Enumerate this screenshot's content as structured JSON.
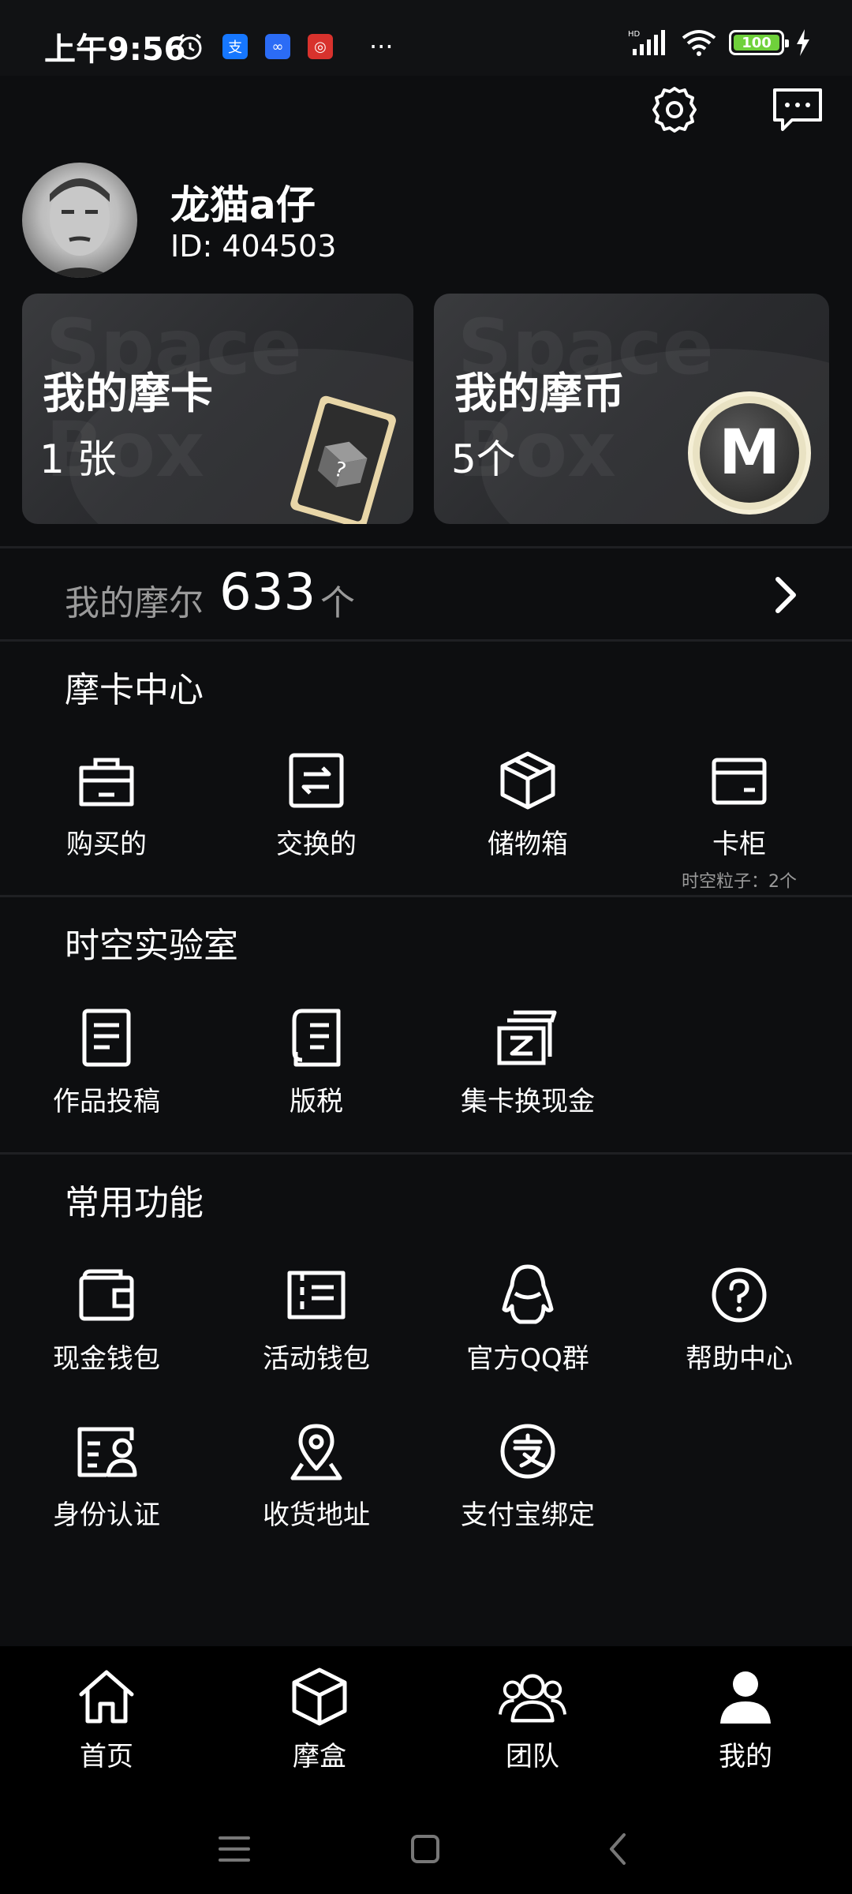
{
  "status_bar": {
    "time": "上午9:56",
    "battery": "100",
    "colors": {
      "battery_fill": "#6fd13b"
    }
  },
  "profile": {
    "name": "龙猫a仔",
    "id": "ID: 404503"
  },
  "cards": [
    {
      "title": "我的摩卡",
      "count": "1 张",
      "watermark_top": "Space",
      "watermark_bottom": "Box"
    },
    {
      "title": "我的摩币",
      "count": "5个",
      "watermark_top": "Space",
      "watermark_bottom": "Box",
      "coin_letter": "M"
    }
  ],
  "mole": {
    "label": "我的摩尔",
    "value": "633",
    "unit": "个"
  },
  "sections": {
    "moka_center": {
      "title": "摩卡中心",
      "items": [
        {
          "label": "购买的",
          "icon": "shopping-bag-icon"
        },
        {
          "label": "交换的",
          "icon": "exchange-icon"
        },
        {
          "label": "储物箱",
          "icon": "box-icon"
        },
        {
          "label": "卡柜",
          "icon": "card-cabinet-icon",
          "sub": "时空粒子：2个"
        }
      ]
    },
    "lab": {
      "title": "时空实验室",
      "items": [
        {
          "label": "作品投稿",
          "icon": "document-icon"
        },
        {
          "label": "版税",
          "icon": "royalty-doc-icon"
        },
        {
          "label": "集卡换现金",
          "icon": "card-cash-icon"
        }
      ]
    },
    "common": {
      "title": "常用功能",
      "items": [
        {
          "label": "现金钱包",
          "icon": "wallet-icon"
        },
        {
          "label": "活动钱包",
          "icon": "ticket-wallet-icon"
        },
        {
          "label": "官方QQ群",
          "icon": "qq-penguin-icon"
        },
        {
          "label": "帮助中心",
          "icon": "help-icon"
        },
        {
          "label": "身份认证",
          "icon": "id-card-icon"
        },
        {
          "label": "收货地址",
          "icon": "location-icon"
        },
        {
          "label": "支付宝绑定",
          "icon": "alipay-icon"
        }
      ]
    }
  },
  "bottom_nav": [
    {
      "label": "首页",
      "icon": "home-icon"
    },
    {
      "label": "摩盒",
      "icon": "cube-icon"
    },
    {
      "label": "团队",
      "icon": "team-icon"
    },
    {
      "label": "我的",
      "icon": "profile-icon",
      "active": true
    }
  ]
}
